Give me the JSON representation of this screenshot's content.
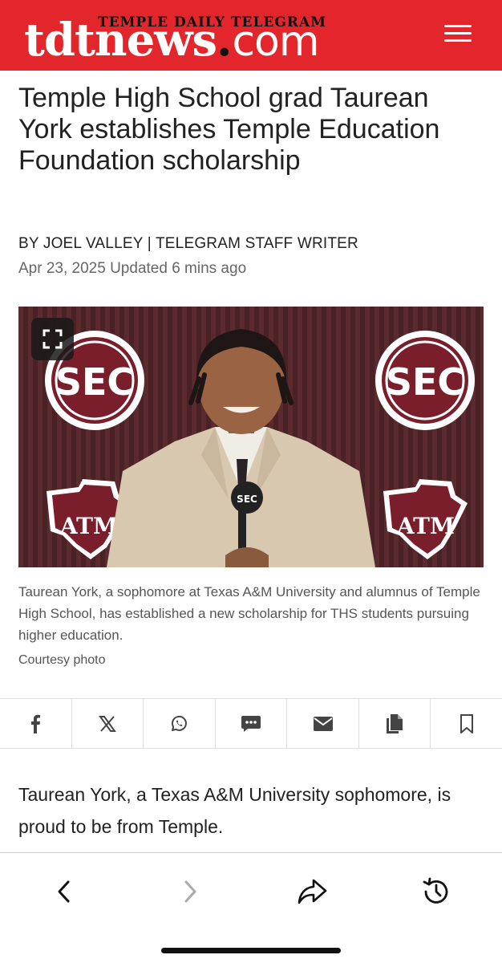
{
  "header": {
    "logo_top": "TEMPLE DAILY TELEGRAM",
    "logo_main": "tdtnews",
    "logo_dot": ".",
    "logo_com": "com",
    "brand_color": "#e2262b"
  },
  "article": {
    "headline": "Temple High School grad Taurean York establishes Temple Education Foundation scholarship",
    "byline": "BY JOEL VALLEY | TELEGRAM STAFF WRITER",
    "date": "Apr 23, 2025 Updated 6 mins ago",
    "photo": {
      "logo_text": "SEC",
      "team_text": "ATM"
    },
    "caption": "Taurean York, a sophomore at Texas A&M University and alumnus of Temple High School, has established a new scholarship for THS students pursuing higher education.",
    "credit": "Courtesy photo",
    "body": "Taurean York, a Texas A&M University sophomore, is proud to be from Temple."
  },
  "share_bar": {
    "icons": [
      "facebook-icon",
      "x-icon",
      "whatsapp-icon",
      "sms-icon",
      "email-icon",
      "copy-icon",
      "bookmark-icon"
    ]
  },
  "browser": {
    "icons": [
      "back-icon",
      "forward-icon",
      "share-icon",
      "history-icon"
    ]
  }
}
